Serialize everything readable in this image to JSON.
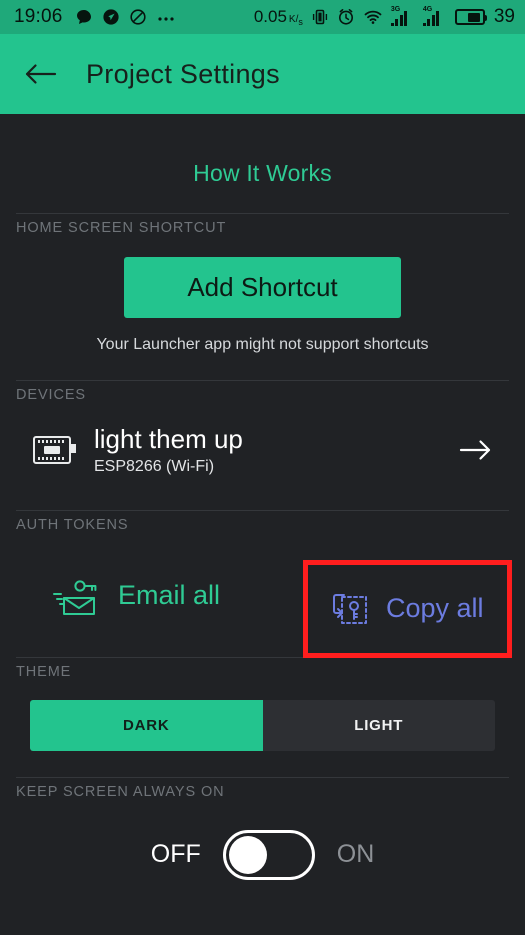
{
  "statusbar": {
    "time": "19:06",
    "icons": [
      "chat-bubble-icon",
      "navigation-arrow-icon",
      "do-not-disturb-icon",
      "more-dots-icon"
    ],
    "network_speed": "0.05",
    "network_speed_unit_top": "K",
    "network_speed_unit_bottom": "s",
    "vibrate_icon": "vibrate-icon",
    "alarm_icon": "alarm-clock-icon",
    "wifi_icon": "wifi-icon",
    "signal_1_label": "3G",
    "signal_2_label": "4G",
    "battery_level": "39"
  },
  "appbar": {
    "back_icon": "back-arrow-icon",
    "title": "Project Settings",
    "background": "#23C48E"
  },
  "content": {
    "how_it_works": "How It Works",
    "sections": {
      "shortcut": {
        "header": "HOME SCREEN SHORTCUT",
        "button_label": "Add Shortcut",
        "hint": "Your Launcher app might not support shortcuts"
      },
      "devices": {
        "header": "DEVICES",
        "items": [
          {
            "icon": "microchip-icon",
            "name": "light them up",
            "subtitle": "ESP8266 (Wi-Fi)",
            "chevron": "right-arrow-icon"
          }
        ]
      },
      "auth_tokens": {
        "header": "AUTH TOKENS",
        "email_icon": "envelope-key-icon",
        "email_label": "Email all",
        "email_color": "#2FCB94",
        "copy_icon": "clipboard-key-icon",
        "copy_label": "Copy all",
        "copy_color": "#6C7CE0",
        "highlight_color": "#FF1E1E"
      },
      "theme": {
        "header": "THEME",
        "options": [
          "DARK",
          "LIGHT"
        ],
        "selected": "DARK"
      },
      "keep_screen_on": {
        "header": "KEEP SCREEN ALWAYS ON",
        "off_label": "OFF",
        "on_label": "ON",
        "state": "OFF"
      }
    }
  }
}
